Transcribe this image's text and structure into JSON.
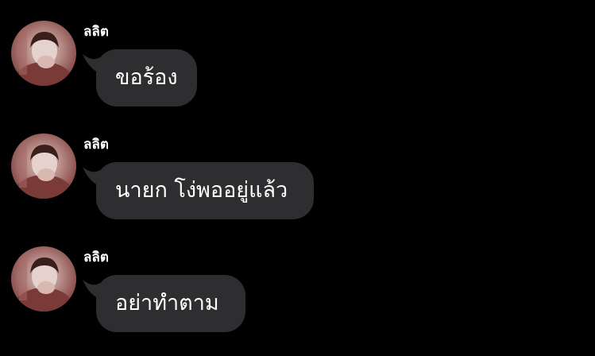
{
  "conversation": {
    "messages": [
      {
        "sender": "ลลิต",
        "text": "ขอร้อง"
      },
      {
        "sender": "ลลิต",
        "text": "นายก โง่พออยู่แล้ว"
      },
      {
        "sender": "ลลิต",
        "text": "อย่าทำตาม"
      }
    ]
  },
  "colors": {
    "background": "#000000",
    "bubble": "#2e2e30",
    "text": "#ffffff"
  }
}
